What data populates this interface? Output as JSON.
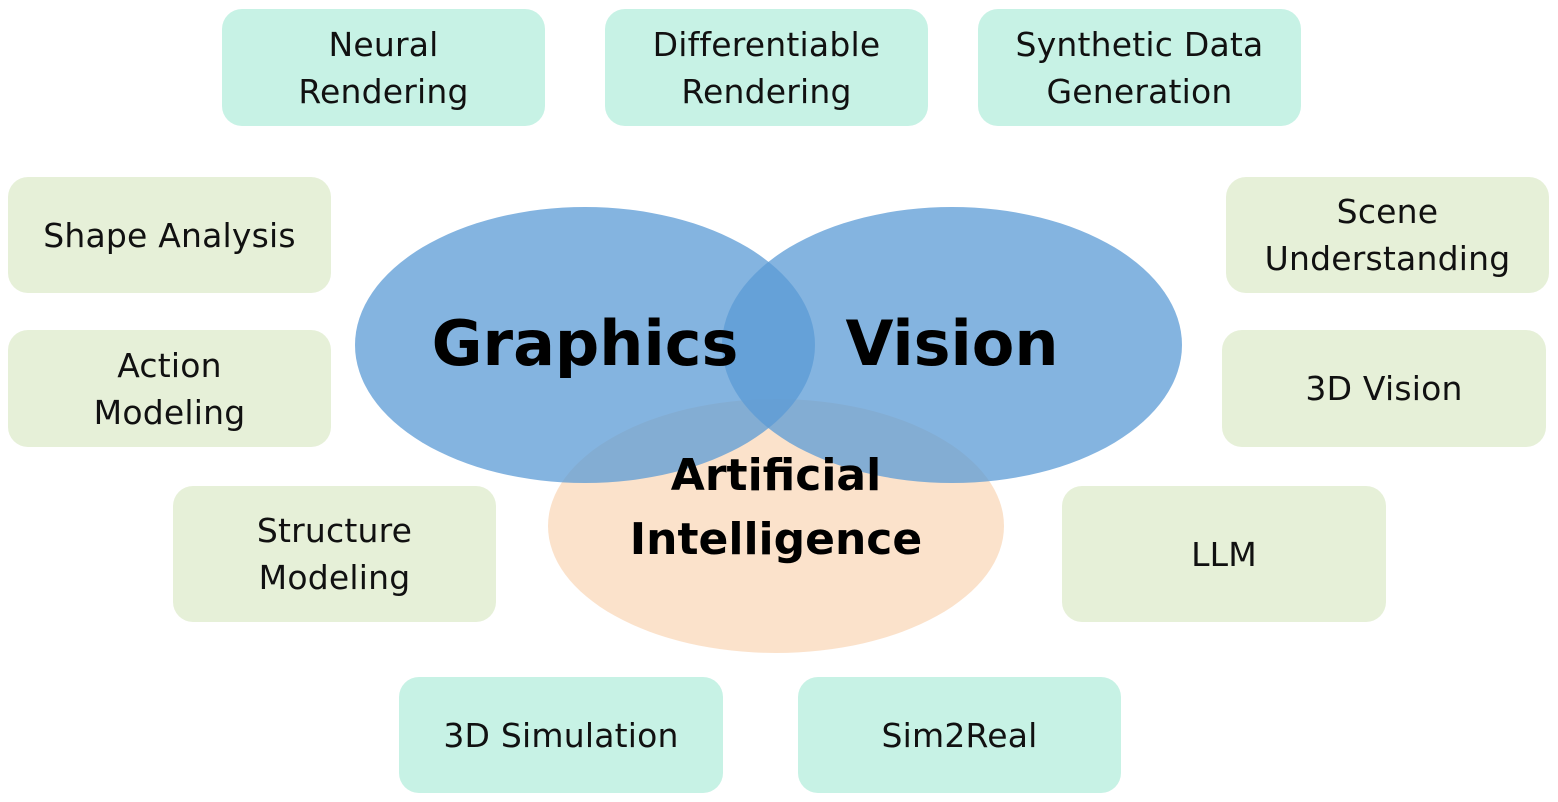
{
  "venn": {
    "circles": [
      {
        "label": "Graphics",
        "color": "#5b9bd5"
      },
      {
        "label": "Vision",
        "color": "#5b9bd5"
      },
      {
        "label": "Artificial\nIntelligence",
        "color": "#f8cba0"
      }
    ]
  },
  "topics": [
    {
      "label": "Neural\nRendering",
      "color": "#c7f2e5"
    },
    {
      "label": "Differentiable\nRendering",
      "color": "#c7f2e5"
    },
    {
      "label": "Synthetic Data\nGeneration",
      "color": "#c7f2e5"
    },
    {
      "label": "Shape Analysis",
      "color": "#e6f0d8"
    },
    {
      "label": "Scene\nUnderstanding",
      "color": "#e6f0d8"
    },
    {
      "label": "Action\nModeling",
      "color": "#e6f0d8"
    },
    {
      "label": "3D Vision",
      "color": "#e6f0d8"
    },
    {
      "label": "Structure\nModeling",
      "color": "#e6f0d8"
    },
    {
      "label": "LLM",
      "color": "#e6f0d8"
    },
    {
      "label": "3D Simulation",
      "color": "#c7f2e5"
    },
    {
      "label": "Sim2Real",
      "color": "#c7f2e5"
    }
  ]
}
